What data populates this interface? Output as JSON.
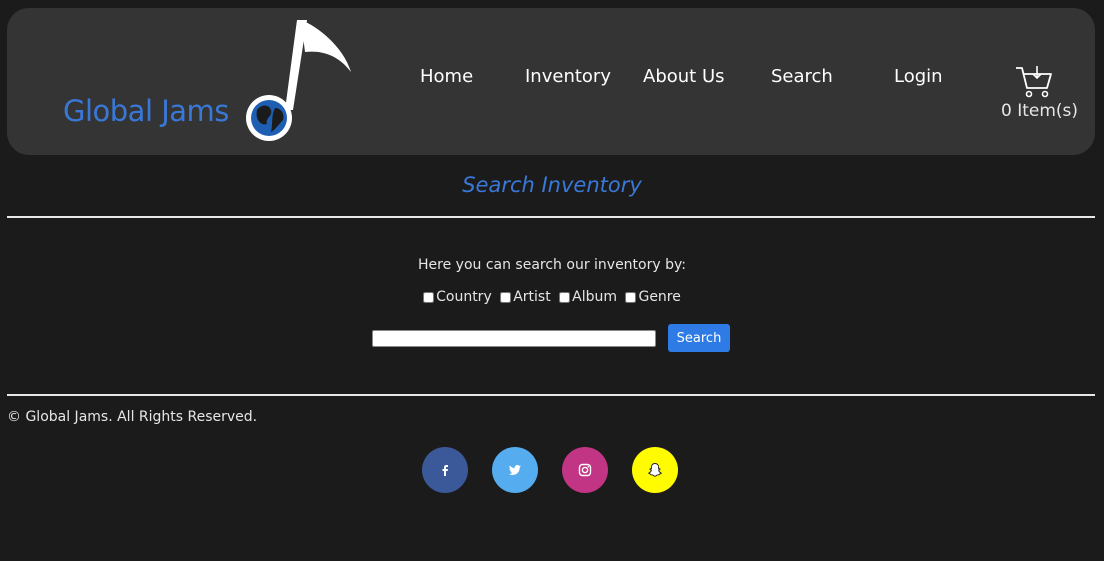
{
  "header": {
    "brand": "Global Jams",
    "nav": [
      {
        "label": "Home"
      },
      {
        "label": "Inventory"
      },
      {
        "label": "About Us"
      },
      {
        "label": "Search"
      },
      {
        "label": "Login"
      }
    ],
    "cart": {
      "count_label": "0 Item(s)",
      "icon": "cart-icon"
    }
  },
  "search_section": {
    "title": "Search Inventory",
    "intro": "Here you can search our inventory by:",
    "filters": [
      {
        "label": "Country",
        "checked": false
      },
      {
        "label": "Artist",
        "checked": false
      },
      {
        "label": "Album",
        "checked": false
      },
      {
        "label": "Genre",
        "checked": false
      }
    ],
    "input": {
      "value": "",
      "placeholder": ""
    },
    "button_label": "Search"
  },
  "footer": {
    "copyright": "© Global Jams. All Rights Reserved.",
    "social": [
      {
        "name": "facebook",
        "glyph": "f",
        "color": "#3b5998"
      },
      {
        "name": "twitter",
        "glyph": "twitter",
        "color": "#55acee"
      },
      {
        "name": "instagram",
        "glyph": "instagram",
        "color": "#c13584"
      },
      {
        "name": "snapchat",
        "glyph": "snapchat",
        "color": "#fffc00"
      }
    ]
  },
  "colors": {
    "background": "#1b1b1b",
    "header": "#343434",
    "accent": "#3a78d8",
    "button": "#2f7be6"
  }
}
